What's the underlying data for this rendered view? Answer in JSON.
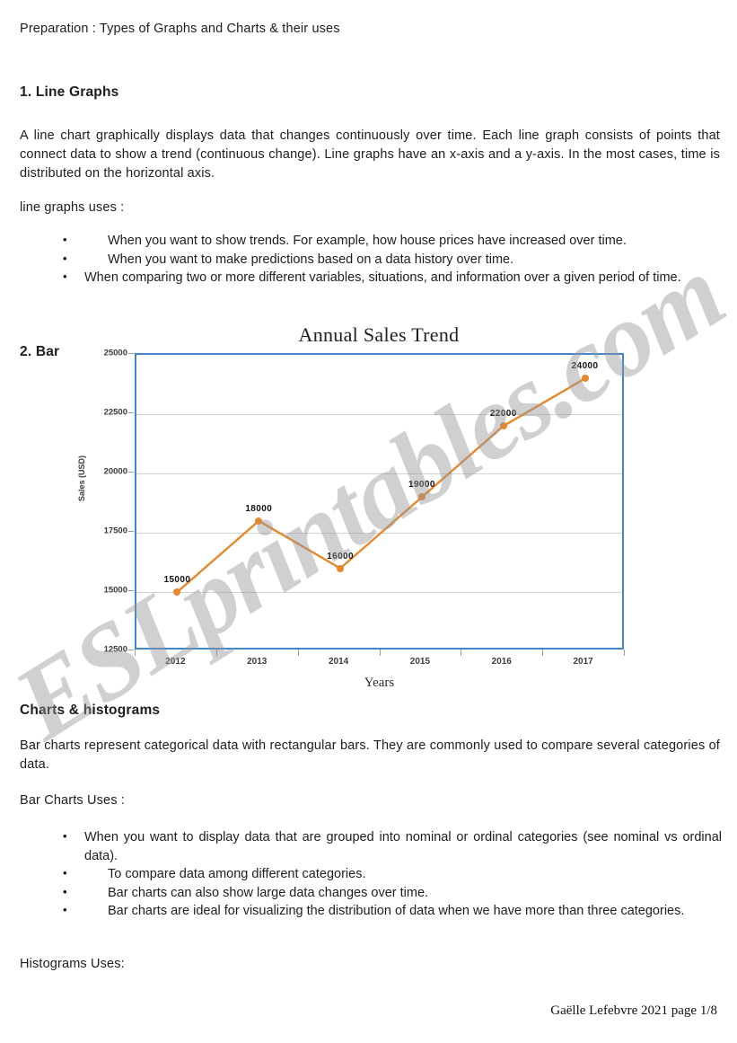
{
  "document": {
    "header": "Preparation : Types of Graphs and Charts & their uses",
    "section1_heading": "1. Line Graphs",
    "section1_paragraph": "A line chart graphically displays data that changes continuously over time. Each line graph consists of points that connect data to show a trend (continuous change). Line graphs have an x-axis and a y-axis. In the most cases, time is distributed on the horizontal axis.",
    "section1_uses_intro": "line graphs uses :",
    "section1_bullets": [
      "When you want to show trends. For example, how house prices have increased over time.",
      "When you want to make predictions based on a data history over time.",
      "When comparing two or more different variables, situations, and information over a given period of time."
    ],
    "section2_number": "2.  Bar",
    "section2_heading": "Charts & histograms",
    "section2_paragraph": "Bar charts represent categorical data with rectangular bars. They are commonly used to compare several categories of data.",
    "section2_uses_intro": "Bar Charts Uses :",
    "section2_bullets": [
      "When you want to display data that are grouped into nominal or ordinal categories (see nominal vs ordinal data).",
      "To compare data among different categories.",
      "Bar charts can also show large data changes over time.",
      "Bar charts are ideal for visualizing the distribution of data when we have more than three categories."
    ],
    "section3_intro": "Histograms Uses:",
    "footer": "Gaëlle Lefebvre 2021 page 1/8",
    "watermark": "ESLprintables.com"
  },
  "chart_data": {
    "type": "line",
    "title": "Annual Sales Trend",
    "xlabel": "Years",
    "ylabel": "Sales (USD)",
    "categories": [
      "2012",
      "2013",
      "2014",
      "2015",
      "2016",
      "2017"
    ],
    "values": [
      15000,
      18000,
      16000,
      19000,
      22000,
      24000
    ],
    "data_labels": [
      "15000",
      "18000",
      "16000",
      "19000",
      "22000",
      "24000"
    ],
    "ylim": [
      12500,
      25000
    ],
    "yticks": [
      12500,
      15000,
      17500,
      20000,
      22500,
      25000
    ],
    "ytick_labels": [
      "12500",
      "15000",
      "17500",
      "20000",
      "22500",
      "25000"
    ],
    "grid": true,
    "legend": false,
    "series_color": "#e8872a",
    "frame_color": "#3f86cf",
    "gridline_color": "#d2d2d2",
    "marker": "circle"
  }
}
